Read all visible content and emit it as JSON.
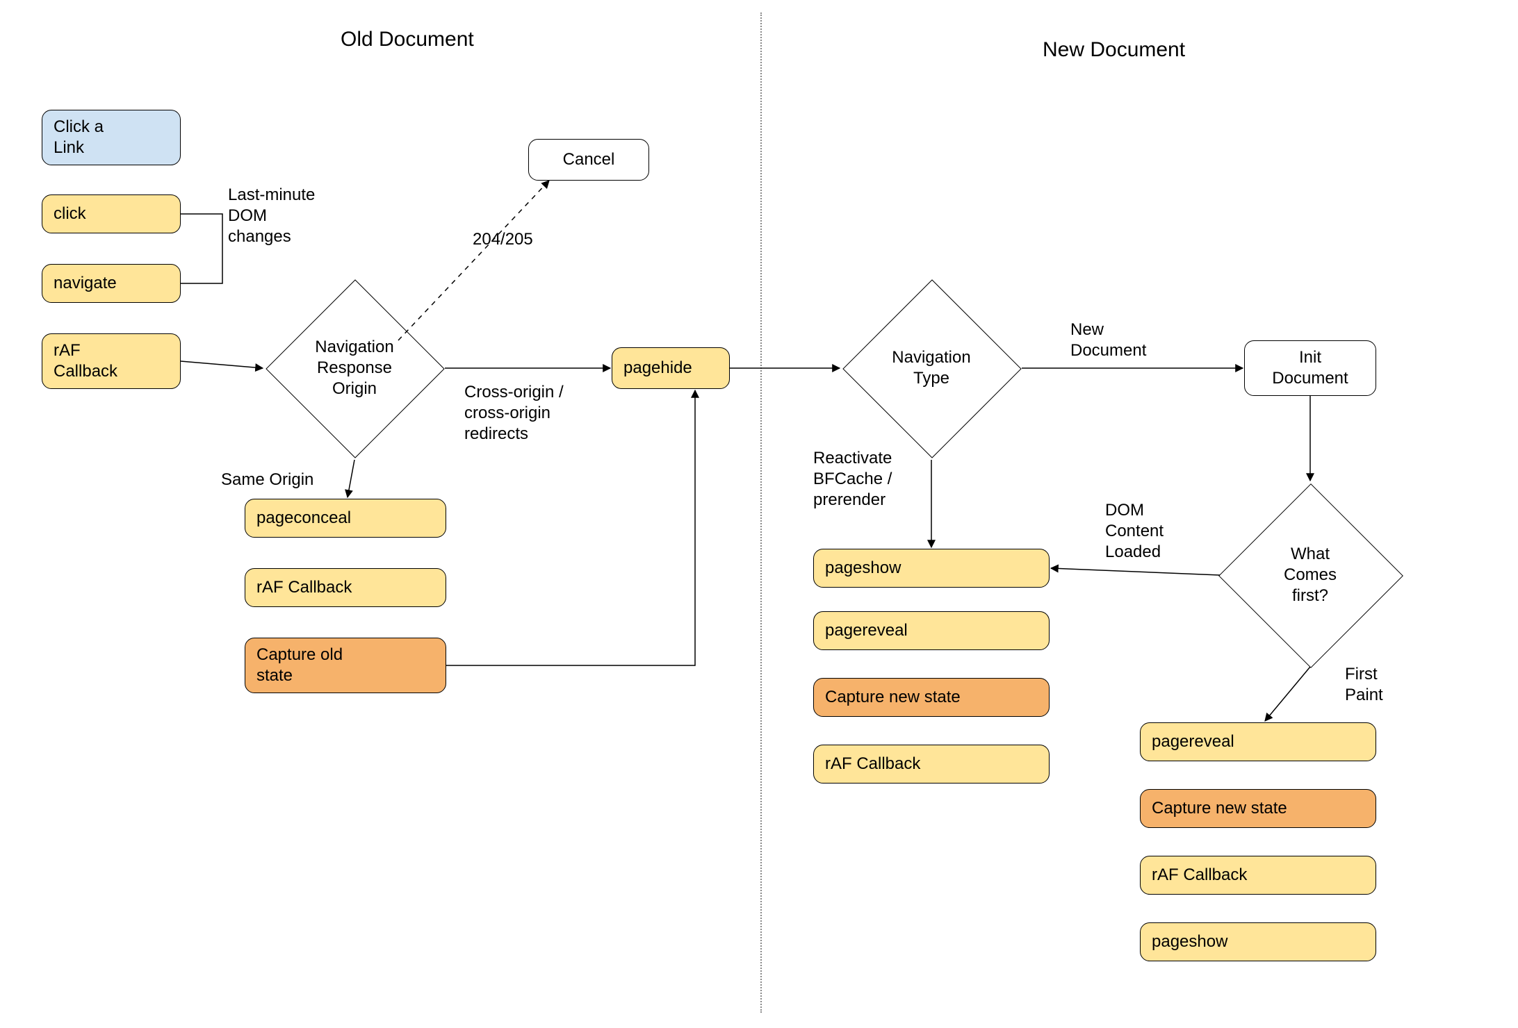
{
  "titles": {
    "old": "Old Document",
    "new": "New Document"
  },
  "nodes": {
    "click_link": "Click a\nLink",
    "click": "click",
    "navigate": "navigate",
    "raf_cb1": "rAF\nCallback",
    "nav_origin": "Navigation\nResponse\nOrigin",
    "cancel": "Cancel",
    "pagehide": "pagehide",
    "pageconceal": "pageconceal",
    "raf_cb2": "rAF Callback",
    "capture_old": "Capture old\nstate",
    "nav_type": "Navigation\nType",
    "init_doc": "Init\nDocument",
    "what_first": "What\nComes\nfirst?",
    "pageshow1": "pageshow",
    "pagereveal1": "pagereveal",
    "capture_new1": "Capture new state",
    "raf_cb3": "rAF Callback",
    "pagereveal2": "pagereveal",
    "capture_new2": "Capture new state",
    "raf_cb4": "rAF Callback",
    "pageshow2": "pageshow"
  },
  "labels": {
    "last_minute": "Last-minute\nDOM\nchanges",
    "e204": "204/205",
    "same_origin": "Same Origin",
    "cross_origin": "Cross-origin /\ncross-origin\nredirects",
    "new_doc": "New\nDocument",
    "reactivate": "Reactivate\nBFCache /\nprerender",
    "dom_loaded": "DOM\nContent\nLoaded",
    "first_paint": "First\nPaint"
  }
}
